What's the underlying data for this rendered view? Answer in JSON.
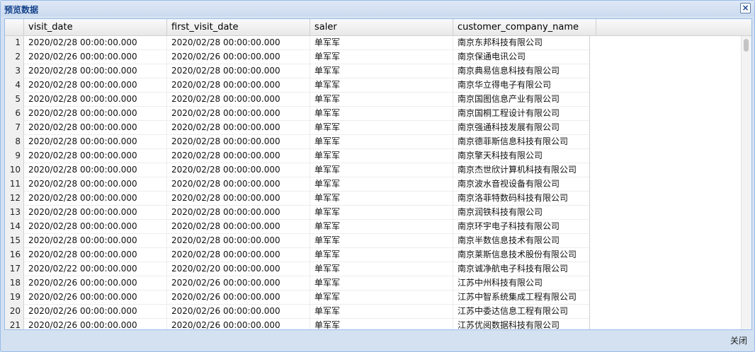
{
  "window": {
    "title": "预览数据"
  },
  "grid": {
    "columns": [
      "visit_date",
      "first_visit_date",
      "saler",
      "customer_company_name"
    ],
    "rows": [
      {
        "n": "1",
        "visit_date": "2020/02/28 00:00:00.000",
        "first_visit_date": "2020/02/28 00:00:00.000",
        "saler": "单军军",
        "company": "南京东邦科技有限公司"
      },
      {
        "n": "2",
        "visit_date": "2020/02/26 00:00:00.000",
        "first_visit_date": "2020/02/26 00:00:00.000",
        "saler": "单军军",
        "company": "南京保通电讯公司"
      },
      {
        "n": "3",
        "visit_date": "2020/02/28 00:00:00.000",
        "first_visit_date": "2020/02/28 00:00:00.000",
        "saler": "单军军",
        "company": "南京典易信息科技有限公司"
      },
      {
        "n": "4",
        "visit_date": "2020/02/28 00:00:00.000",
        "first_visit_date": "2020/02/28 00:00:00.000",
        "saler": "单军军",
        "company": "南京华立得电子有限公司"
      },
      {
        "n": "5",
        "visit_date": "2020/02/28 00:00:00.000",
        "first_visit_date": "2020/02/28 00:00:00.000",
        "saler": "单军军",
        "company": "南京国图信息产业有限公司"
      },
      {
        "n": "6",
        "visit_date": "2020/02/28 00:00:00.000",
        "first_visit_date": "2020/02/28 00:00:00.000",
        "saler": "单军军",
        "company": "南京国桐工程设计有限公司"
      },
      {
        "n": "7",
        "visit_date": "2020/02/28 00:00:00.000",
        "first_visit_date": "2020/02/28 00:00:00.000",
        "saler": "单军军",
        "company": "南京强通科技发展有限公司"
      },
      {
        "n": "8",
        "visit_date": "2020/02/28 00:00:00.000",
        "first_visit_date": "2020/02/28 00:00:00.000",
        "saler": "单军军",
        "company": "南京德菲斯信息科技有限公司"
      },
      {
        "n": "9",
        "visit_date": "2020/02/28 00:00:00.000",
        "first_visit_date": "2020/02/28 00:00:00.000",
        "saler": "单军军",
        "company": "南京擎天科技有限公司"
      },
      {
        "n": "10",
        "visit_date": "2020/02/28 00:00:00.000",
        "first_visit_date": "2020/02/28 00:00:00.000",
        "saler": "单军军",
        "company": "南京杰世欣计算机科技有限公司"
      },
      {
        "n": "11",
        "visit_date": "2020/02/28 00:00:00.000",
        "first_visit_date": "2020/02/28 00:00:00.000",
        "saler": "单军军",
        "company": "南京波水音视设备有限公司"
      },
      {
        "n": "12",
        "visit_date": "2020/02/28 00:00:00.000",
        "first_visit_date": "2020/02/28 00:00:00.000",
        "saler": "单军军",
        "company": "南京洛菲特数码科技有限公司"
      },
      {
        "n": "13",
        "visit_date": "2020/02/28 00:00:00.000",
        "first_visit_date": "2020/02/28 00:00:00.000",
        "saler": "单军军",
        "company": "南京润铁科技有限公司"
      },
      {
        "n": "14",
        "visit_date": "2020/02/28 00:00:00.000",
        "first_visit_date": "2020/02/28 00:00:00.000",
        "saler": "单军军",
        "company": "南京环宇电子科技有限公司"
      },
      {
        "n": "15",
        "visit_date": "2020/02/28 00:00:00.000",
        "first_visit_date": "2020/02/28 00:00:00.000",
        "saler": "单军军",
        "company": "南京半数信息技术有限公司"
      },
      {
        "n": "16",
        "visit_date": "2020/02/28 00:00:00.000",
        "first_visit_date": "2020/02/28 00:00:00.000",
        "saler": "单军军",
        "company": "南京莱斯信息技术股份有限公司"
      },
      {
        "n": "17",
        "visit_date": "2020/02/22 00:00:00.000",
        "first_visit_date": "2020/02/20 00:00:00.000",
        "saler": "单军军",
        "company": "南京诚净航电子科技有限公司"
      },
      {
        "n": "18",
        "visit_date": "2020/02/26 00:00:00.000",
        "first_visit_date": "2020/02/26 00:00:00.000",
        "saler": "单军军",
        "company": "江苏中州科技有限公司"
      },
      {
        "n": "19",
        "visit_date": "2020/02/26 00:00:00.000",
        "first_visit_date": "2020/02/26 00:00:00.000",
        "saler": "单军军",
        "company": "江苏中智系统集成工程有限公司"
      },
      {
        "n": "20",
        "visit_date": "2020/02/26 00:00:00.000",
        "first_visit_date": "2020/02/26 00:00:00.000",
        "saler": "单军军",
        "company": "江苏中委达信息工程有限公司"
      },
      {
        "n": "21",
        "visit_date": "2020/02/26 00:00:00.000",
        "first_visit_date": "2020/02/26 00:00:00.000",
        "saler": "单军军",
        "company": "江苏优阅数据科技有限公司"
      }
    ]
  },
  "footer": {
    "close_label": "关闭"
  }
}
